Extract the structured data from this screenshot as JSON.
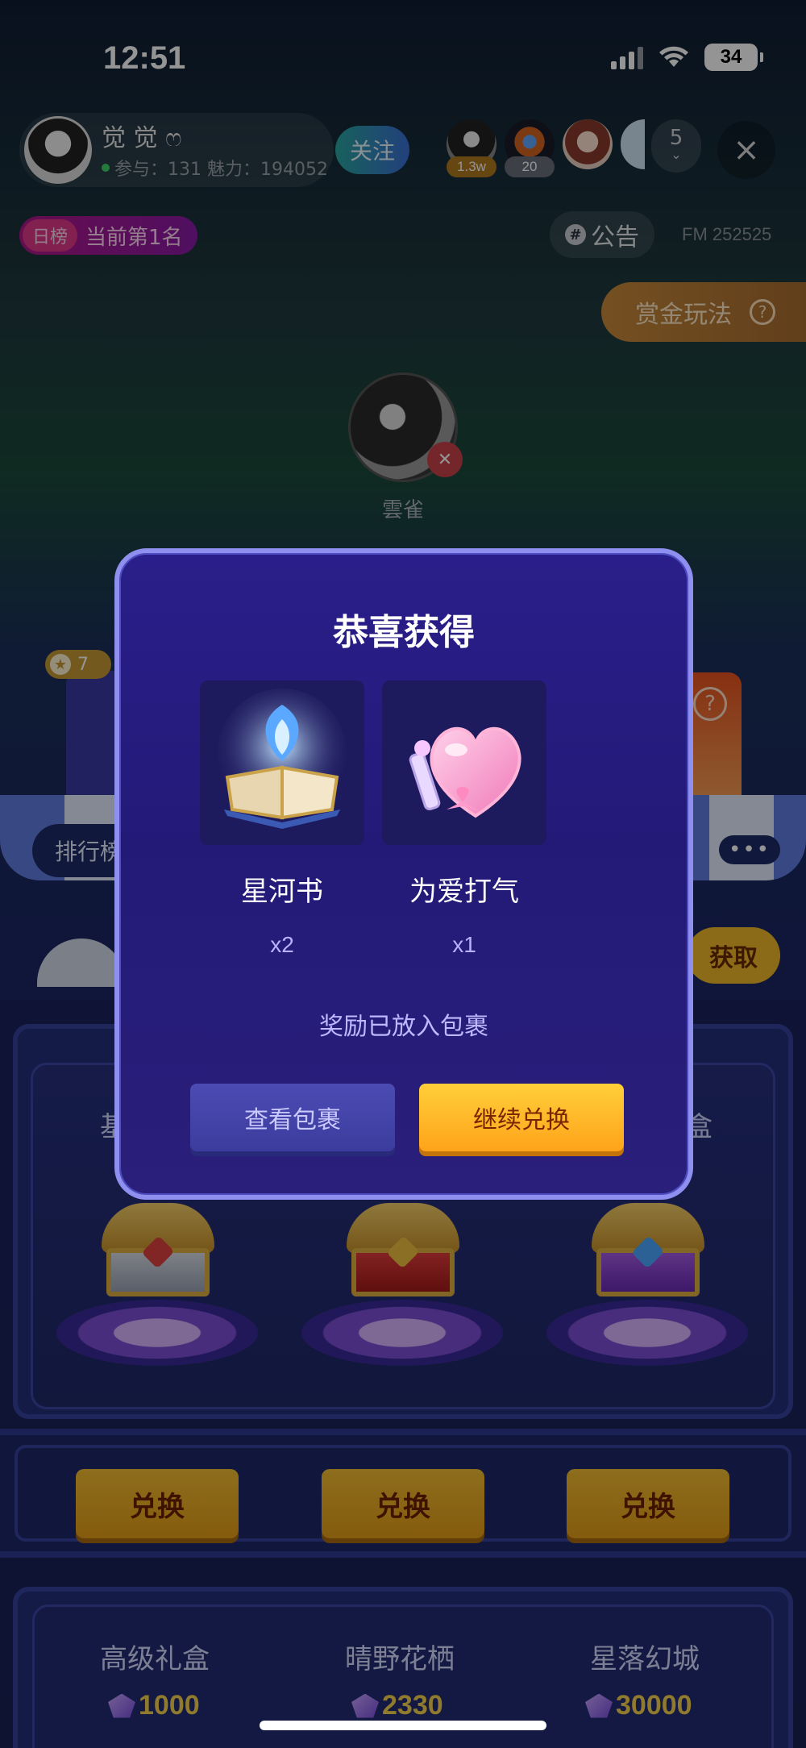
{
  "status_bar": {
    "time": "12:51",
    "battery": "34"
  },
  "host": {
    "name": "觉 觉 ෆ",
    "stats": "参与：131 魅力：194052",
    "follow_label": "关注"
  },
  "viewers": {
    "badges": [
      "1.3w",
      "20"
    ],
    "more_count": "5",
    "close_icon": "×"
  },
  "rank": {
    "tag": "日榜",
    "text": "当前第1名"
  },
  "notice": {
    "label": "公告",
    "icon": "#"
  },
  "room_id": "FM 252525",
  "bounty": {
    "label": "赏金玩法",
    "help_icon": "?"
  },
  "mic": {
    "name": "雲雀"
  },
  "side": {
    "star_count": "7",
    "ranking_label": "排行榜",
    "more_label": "•••",
    "get_label": "获取",
    "help_icon": "?"
  },
  "shop": {
    "shelf_labels": [
      "基",
      "盒"
    ],
    "exchange_labels": [
      "兑换",
      "兑换",
      "兑换"
    ],
    "gifts": [
      {
        "name": "高级礼盒",
        "price": "1000"
      },
      {
        "name": "晴野花栖",
        "price": "2330"
      },
      {
        "name": "星落幻城",
        "price": "30000"
      }
    ]
  },
  "modal": {
    "title": "恭喜获得",
    "rewards": [
      {
        "name": "星河书",
        "count": "x2"
      },
      {
        "name": "为爱打气",
        "count": "x1"
      }
    ],
    "note": "奖励已放入包裹",
    "view_bag_label": "查看包裹",
    "continue_label": "继续兑换"
  },
  "colors": {
    "accent_gold": "#ffb020",
    "modal_bg": "#231a78",
    "modal_border": "#8f8ff0"
  }
}
